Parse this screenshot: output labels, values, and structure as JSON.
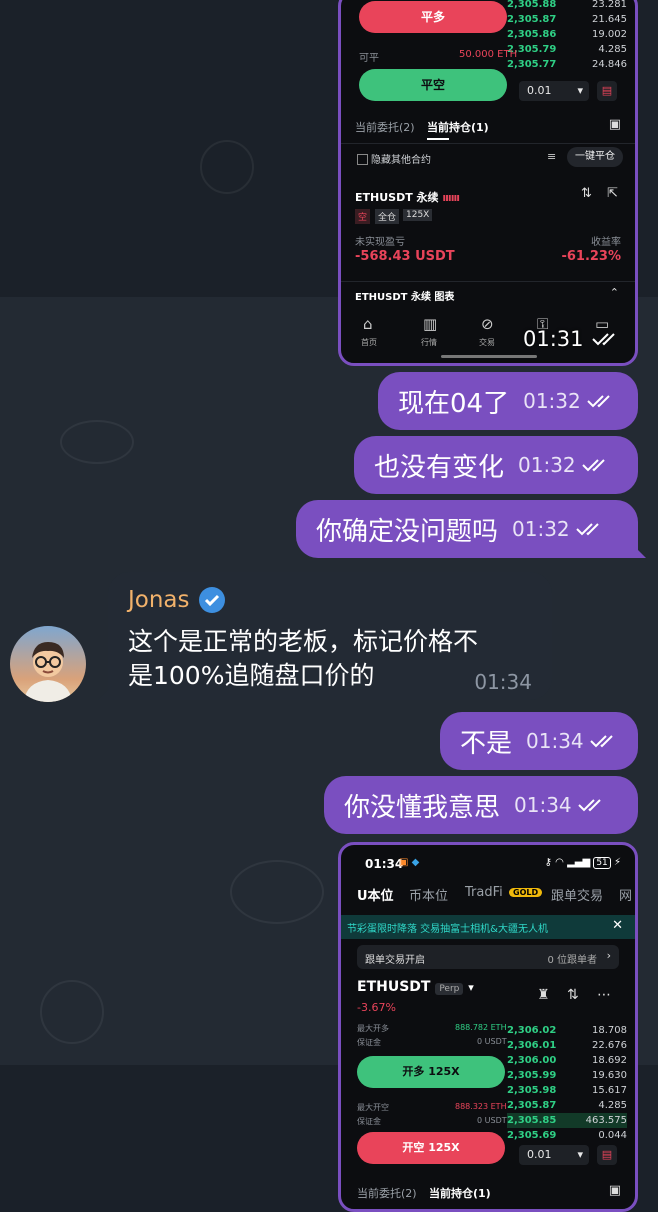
{
  "shot1": {
    "close_long": "平多",
    "ob_rows": [
      {
        "p": "2,305.88",
        "q": "23.281"
      },
      {
        "p": "2,305.87",
        "q": "21.645"
      },
      {
        "p": "2,305.86",
        "q": "19.002"
      },
      {
        "p": "2,305.79",
        "q": "4.285"
      },
      {
        "p": "2,305.77",
        "q": "24.846"
      }
    ],
    "closable_label": "可平",
    "closable_value": "50.000 ETH",
    "close_short": "平空",
    "step": "0.01",
    "tab_orders": "当前委托(2)",
    "tab_positions": "当前持仓(1)",
    "hide_others": "隐藏其他合约",
    "close_all": "一键平仓",
    "symbol": "ETHUSDT 永续",
    "tag_short": "空",
    "tag_cross": "全仓",
    "tag_lev": "125X",
    "pnl_label": "未实现盈亏",
    "pnl_value": "-568.43 USDT",
    "roi_label": "收益率",
    "roi_value": "-61.23%",
    "chart_row": "ETHUSDT 永续 图表",
    "nav": [
      "首页",
      "行情",
      "交易"
    ],
    "time": "01:31"
  },
  "messages": [
    {
      "text": "现在04了",
      "time": "01:32"
    },
    {
      "text": "也没有变化",
      "time": "01:32"
    },
    {
      "text": "你确定没问题吗",
      "time": "01:32"
    }
  ],
  "incoming": {
    "name": "Jonas",
    "line1": "这个是正常的老板，标记价格不",
    "line2": "是100%追随盘口价的",
    "time": "01:34"
  },
  "messages2": [
    {
      "text": "不是",
      "time": "01:34"
    },
    {
      "text": "你没懂我意思",
      "time": "01:34"
    }
  ],
  "shot2": {
    "status_time": "01:34",
    "battery": "51",
    "tabs": [
      "U本位",
      "币本位",
      "TradFi",
      "跟单交易",
      "网"
    ],
    "gold_badge": "GOLD",
    "banner": "节彩蛋限时降落 交易抽富士相机&大疆无人机",
    "copy_label": "跟单交易开启",
    "copy_count": "0 位跟单者",
    "symbol": "ETHUSDT",
    "perp": "Perp",
    "change": "-3.67%",
    "max_long_label": "最大开多",
    "max_long": "888.782 ETH",
    "margin_label": "保证金",
    "margin": "0 USDT",
    "open_long": "开多 125X",
    "max_short_label": "最大开空",
    "max_short": "888.323 ETH",
    "margin_label2": "保证金",
    "margin2": "0 USDT",
    "open_short": "开空 125X",
    "step": "0.01",
    "ob_rows": [
      {
        "p": "2,306.02",
        "q": "18.708"
      },
      {
        "p": "2,306.01",
        "q": "22.676"
      },
      {
        "p": "2,306.00",
        "q": "18.692"
      },
      {
        "p": "2,305.99",
        "q": "19.630"
      },
      {
        "p": "2,305.98",
        "q": "15.617"
      },
      {
        "p": "2,305.87",
        "q": "4.285"
      },
      {
        "p": "2,305.85",
        "q": "463.575"
      },
      {
        "p": "2,305.69",
        "q": "0.044"
      }
    ],
    "tab_orders": "当前委托(2)",
    "tab_positions": "当前持仓(1)"
  },
  "colors": {
    "bubble_out": "#7a4fc0",
    "bubble_in": "#232a34",
    "name": "#f2b26b",
    "green": "#2fcf85",
    "red": "#e9445a"
  }
}
